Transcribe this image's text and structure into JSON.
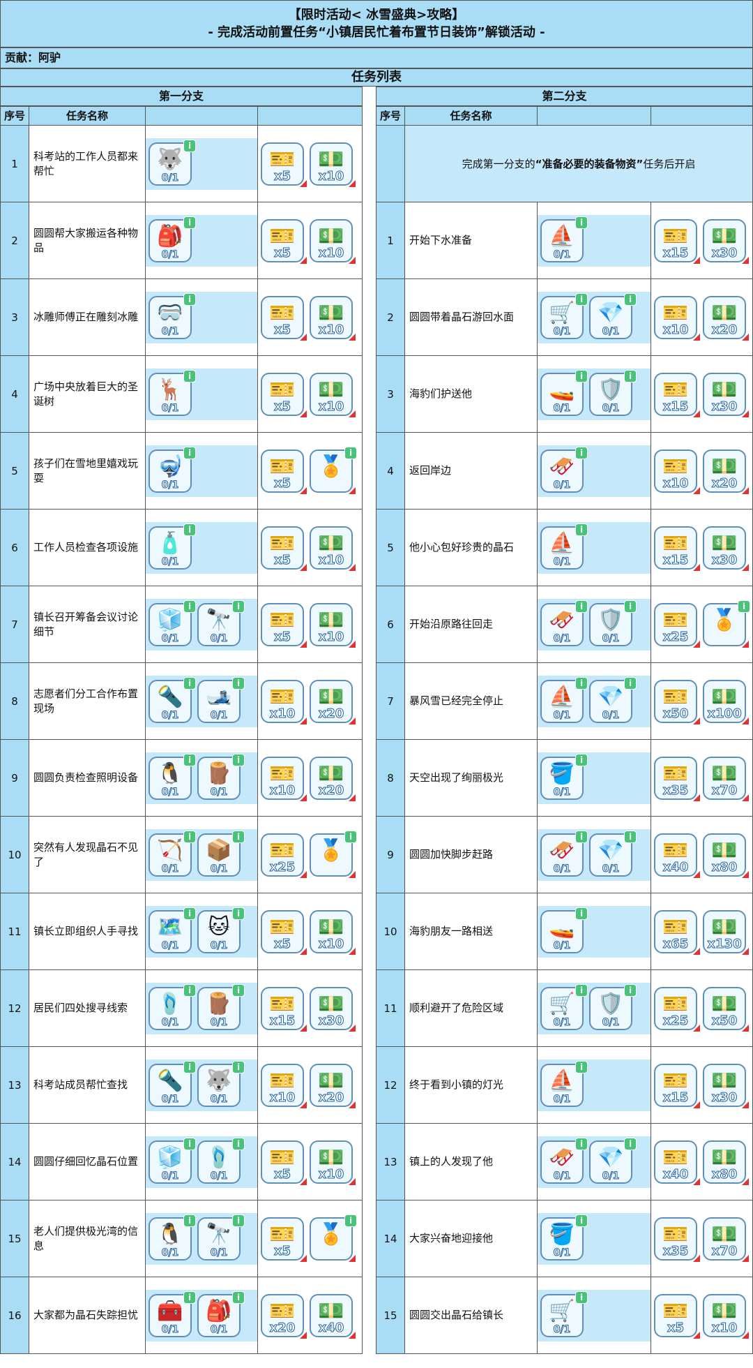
{
  "header": {
    "title": "【限时活动< 冰雪盛典>攻略】",
    "subtitle": "- 完成活动前置任务“小镇居民忙着布置节日装饰”解锁活动 -",
    "credit": "贡献：阿驴",
    "list_title": "任务列表"
  },
  "icons": {
    "husky": "🐺",
    "backpack": "🎒",
    "goggles": "🥽",
    "reindeer": "🦌",
    "snorkel": "🤿",
    "thermos": "🧴",
    "figurine": "🧊",
    "binoculars": "🔭",
    "flashlight": "🔦",
    "skis": "🎿",
    "penguin": "🐧",
    "planks": "🪵",
    "slingshot": "🏹",
    "crate": "📦",
    "map": "🗺️",
    "cat": "🐱",
    "flippers": "🩴",
    "firstaid": "🧰",
    "boat": "⛵",
    "cart": "🛒",
    "crystal": "💎",
    "jetski": "🚤",
    "shield": "🛡️",
    "sled": "🛷",
    "cup": "🪣",
    "ticket": "🎫",
    "cash": "💵",
    "badge": "🏅",
    "info": "i"
  },
  "left": {
    "branch_title": "第一分支",
    "col_num": "序号",
    "col_name": "任务名称",
    "rows": [
      {
        "num": "1",
        "name": "科考站的工作人员都来帮忙",
        "materials": [
          {
            "icon": "husky",
            "qty": "0/1"
          }
        ],
        "rewards": [
          {
            "icon": "ticket",
            "qty": "x5"
          },
          {
            "icon": "cash",
            "qty": "x10"
          }
        ]
      },
      {
        "num": "2",
        "name": "圆圆帮大家搬运各种物品",
        "materials": [
          {
            "icon": "backpack",
            "qty": "0/1"
          }
        ],
        "rewards": [
          {
            "icon": "ticket",
            "qty": "x5"
          },
          {
            "icon": "cash",
            "qty": "x10"
          }
        ]
      },
      {
        "num": "3",
        "name": "冰雕师傅正在雕刻冰雕",
        "materials": [
          {
            "icon": "goggles",
            "qty": "0/1"
          }
        ],
        "rewards": [
          {
            "icon": "ticket",
            "qty": "x5"
          },
          {
            "icon": "cash",
            "qty": "x10"
          }
        ]
      },
      {
        "num": "4",
        "name": "广场中央放着巨大的圣诞树",
        "materials": [
          {
            "icon": "reindeer",
            "qty": "0/1"
          }
        ],
        "rewards": [
          {
            "icon": "ticket",
            "qty": "x5"
          },
          {
            "icon": "cash",
            "qty": "x10"
          }
        ]
      },
      {
        "num": "5",
        "name": "孩子们在雪地里嬉戏玩耍",
        "materials": [
          {
            "icon": "snorkel",
            "qty": "0/1"
          }
        ],
        "rewards": [
          {
            "icon": "ticket",
            "qty": "x5"
          },
          {
            "icon": "badge",
            "qty": ""
          }
        ]
      },
      {
        "num": "6",
        "name": "工作人员检查各项设施",
        "materials": [
          {
            "icon": "thermos",
            "qty": "0/1"
          }
        ],
        "rewards": [
          {
            "icon": "ticket",
            "qty": "x5"
          },
          {
            "icon": "cash",
            "qty": "x10"
          }
        ]
      },
      {
        "num": "7",
        "name": "镇长召开筹备会议讨论细节",
        "materials": [
          {
            "icon": "figurine",
            "qty": "0/1"
          },
          {
            "icon": "binoculars",
            "qty": "0/1"
          }
        ],
        "rewards": [
          {
            "icon": "ticket",
            "qty": "x5"
          },
          {
            "icon": "cash",
            "qty": "x10"
          }
        ]
      },
      {
        "num": "8",
        "name": "志愿者们分工合作布置现场",
        "materials": [
          {
            "icon": "flashlight",
            "qty": "0/1"
          },
          {
            "icon": "skis",
            "qty": "0/1"
          }
        ],
        "rewards": [
          {
            "icon": "ticket",
            "qty": "x10"
          },
          {
            "icon": "cash",
            "qty": "x20"
          }
        ]
      },
      {
        "num": "9",
        "name": "圆圆负责检查照明设备",
        "materials": [
          {
            "icon": "penguin",
            "qty": "0/1"
          },
          {
            "icon": "planks",
            "qty": "0/1"
          }
        ],
        "rewards": [
          {
            "icon": "ticket",
            "qty": "x10"
          },
          {
            "icon": "cash",
            "qty": "x20"
          }
        ]
      },
      {
        "num": "10",
        "name": "突然有人发现晶石不见了",
        "materials": [
          {
            "icon": "slingshot",
            "qty": "0/1"
          },
          {
            "icon": "crate",
            "qty": "0/1"
          }
        ],
        "rewards": [
          {
            "icon": "ticket",
            "qty": "x25"
          },
          {
            "icon": "badge",
            "qty": ""
          }
        ]
      },
      {
        "num": "11",
        "name": "镇长立即组织人手寻找",
        "materials": [
          {
            "icon": "map",
            "qty": "0/1"
          },
          {
            "icon": "cat",
            "qty": "0/1"
          }
        ],
        "rewards": [
          {
            "icon": "ticket",
            "qty": "x5"
          },
          {
            "icon": "cash",
            "qty": "x10"
          }
        ]
      },
      {
        "num": "12",
        "name": "居民们四处搜寻线索",
        "materials": [
          {
            "icon": "flippers",
            "qty": "0/1"
          },
          {
            "icon": "planks",
            "qty": "0/1"
          }
        ],
        "rewards": [
          {
            "icon": "ticket",
            "qty": "x15"
          },
          {
            "icon": "cash",
            "qty": "x30"
          }
        ]
      },
      {
        "num": "13",
        "name": "科考站成员帮忙查找",
        "materials": [
          {
            "icon": "flashlight",
            "qty": "0/1"
          },
          {
            "icon": "husky",
            "qty": "0/1"
          }
        ],
        "rewards": [
          {
            "icon": "ticket",
            "qty": "x10"
          },
          {
            "icon": "cash",
            "qty": "x20"
          }
        ]
      },
      {
        "num": "14",
        "name": "圆圆仔细回忆晶石位置",
        "materials": [
          {
            "icon": "figurine",
            "qty": "0/1"
          },
          {
            "icon": "flippers",
            "qty": "0/1"
          }
        ],
        "rewards": [
          {
            "icon": "ticket",
            "qty": "x5"
          },
          {
            "icon": "cash",
            "qty": "x10"
          }
        ]
      },
      {
        "num": "15",
        "name": "老人们提供极光湾的信息",
        "materials": [
          {
            "icon": "penguin",
            "qty": "0/1"
          },
          {
            "icon": "binoculars",
            "qty": "0/1"
          }
        ],
        "rewards": [
          {
            "icon": "ticket",
            "qty": "x5"
          },
          {
            "icon": "badge",
            "qty": ""
          }
        ]
      },
      {
        "num": "16",
        "name": "大家都为晶石失踪担忧",
        "materials": [
          {
            "icon": "firstaid",
            "qty": "0/1"
          },
          {
            "icon": "backpack",
            "qty": "0/1"
          }
        ],
        "rewards": [
          {
            "icon": "ticket",
            "qty": "x20"
          },
          {
            "icon": "cash",
            "qty": "x40"
          }
        ]
      }
    ]
  },
  "right": {
    "branch_title": "第二分支",
    "col_num": "序号",
    "col_name": "任务名称",
    "unlock_prefix": "完成第一分支的",
    "unlock_bold": "“准备必要的装备物资”",
    "unlock_suffix": "任务后开启",
    "rows": [
      {
        "num": "1",
        "name": "开始下水准备",
        "materials": [
          {
            "icon": "boat",
            "qty": "0/1"
          }
        ],
        "rewards": [
          {
            "icon": "ticket",
            "qty": "x15"
          },
          {
            "icon": "cash",
            "qty": "x30"
          }
        ]
      },
      {
        "num": "2",
        "name": "圆圆带着晶石游回水面",
        "materials": [
          {
            "icon": "cart",
            "qty": "0/1"
          },
          {
            "icon": "crystal",
            "qty": "0/1"
          }
        ],
        "rewards": [
          {
            "icon": "ticket",
            "qty": "x10"
          },
          {
            "icon": "cash",
            "qty": "x20"
          }
        ]
      },
      {
        "num": "3",
        "name": "海豹们护送他",
        "materials": [
          {
            "icon": "jetski",
            "qty": "0/1"
          },
          {
            "icon": "shield",
            "qty": "0/1"
          }
        ],
        "rewards": [
          {
            "icon": "ticket",
            "qty": "x15"
          },
          {
            "icon": "cash",
            "qty": "x30"
          }
        ]
      },
      {
        "num": "4",
        "name": "返回岸边",
        "materials": [
          {
            "icon": "sled",
            "qty": "0/1"
          }
        ],
        "rewards": [
          {
            "icon": "ticket",
            "qty": "x10"
          },
          {
            "icon": "cash",
            "qty": "x20"
          }
        ]
      },
      {
        "num": "5",
        "name": "他小心包好珍贵的晶石",
        "materials": [
          {
            "icon": "boat",
            "qty": "0/1"
          }
        ],
        "rewards": [
          {
            "icon": "ticket",
            "qty": "x15"
          },
          {
            "icon": "cash",
            "qty": "x30"
          }
        ]
      },
      {
        "num": "6",
        "name": "开始沿原路往回走",
        "materials": [
          {
            "icon": "sled",
            "qty": "0/1"
          },
          {
            "icon": "shield",
            "qty": "0/1"
          }
        ],
        "rewards": [
          {
            "icon": "ticket",
            "qty": "x25"
          },
          {
            "icon": "badge",
            "qty": ""
          }
        ]
      },
      {
        "num": "7",
        "name": "暴风雪已经完全停止",
        "materials": [
          {
            "icon": "boat",
            "qty": "0/1"
          },
          {
            "icon": "crystal",
            "qty": "0/1"
          }
        ],
        "rewards": [
          {
            "icon": "ticket",
            "qty": "x50"
          },
          {
            "icon": "cash",
            "qty": "x100"
          }
        ]
      },
      {
        "num": "8",
        "name": "天空出现了绚丽极光",
        "materials": [
          {
            "icon": "cup",
            "qty": "0/1"
          }
        ],
        "rewards": [
          {
            "icon": "ticket",
            "qty": "x35"
          },
          {
            "icon": "cash",
            "qty": "x70"
          }
        ]
      },
      {
        "num": "9",
        "name": "圆圆加快脚步赶路",
        "materials": [
          {
            "icon": "sled",
            "qty": "0/1"
          },
          {
            "icon": "crystal",
            "qty": "0/1"
          }
        ],
        "rewards": [
          {
            "icon": "ticket",
            "qty": "x40"
          },
          {
            "icon": "cash",
            "qty": "x80"
          }
        ]
      },
      {
        "num": "10",
        "name": "海豹朋友一路相送",
        "materials": [
          {
            "icon": "jetski",
            "qty": "0/1"
          }
        ],
        "rewards": [
          {
            "icon": "ticket",
            "qty": "x65"
          },
          {
            "icon": "cash",
            "qty": "x130"
          }
        ]
      },
      {
        "num": "11",
        "name": "顺利避开了危险区域",
        "materials": [
          {
            "icon": "cart",
            "qty": "0/1"
          },
          {
            "icon": "shield",
            "qty": "0/1"
          }
        ],
        "rewards": [
          {
            "icon": "ticket",
            "qty": "x25"
          },
          {
            "icon": "cash",
            "qty": "x50"
          }
        ]
      },
      {
        "num": "12",
        "name": "终于看到小镇的灯光",
        "materials": [
          {
            "icon": "boat",
            "qty": "0/1"
          }
        ],
        "rewards": [
          {
            "icon": "ticket",
            "qty": "x15"
          },
          {
            "icon": "cash",
            "qty": "x30"
          }
        ]
      },
      {
        "num": "13",
        "name": "镇上的人发现了他",
        "materials": [
          {
            "icon": "sled",
            "qty": "0/1"
          },
          {
            "icon": "crystal",
            "qty": "0/1"
          }
        ],
        "rewards": [
          {
            "icon": "ticket",
            "qty": "x40"
          },
          {
            "icon": "cash",
            "qty": "x80"
          }
        ]
      },
      {
        "num": "14",
        "name": "大家兴奋地迎接他",
        "materials": [
          {
            "icon": "cup",
            "qty": "0/1"
          }
        ],
        "rewards": [
          {
            "icon": "ticket",
            "qty": "x35"
          },
          {
            "icon": "cash",
            "qty": "x70"
          }
        ]
      },
      {
        "num": "15",
        "name": "圆圆交出晶石给镇长",
        "materials": [
          {
            "icon": "cart",
            "qty": "0/1"
          }
        ],
        "rewards": [
          {
            "icon": "ticket",
            "qty": "x5"
          },
          {
            "icon": "cash",
            "qty": "x10"
          }
        ]
      }
    ]
  }
}
